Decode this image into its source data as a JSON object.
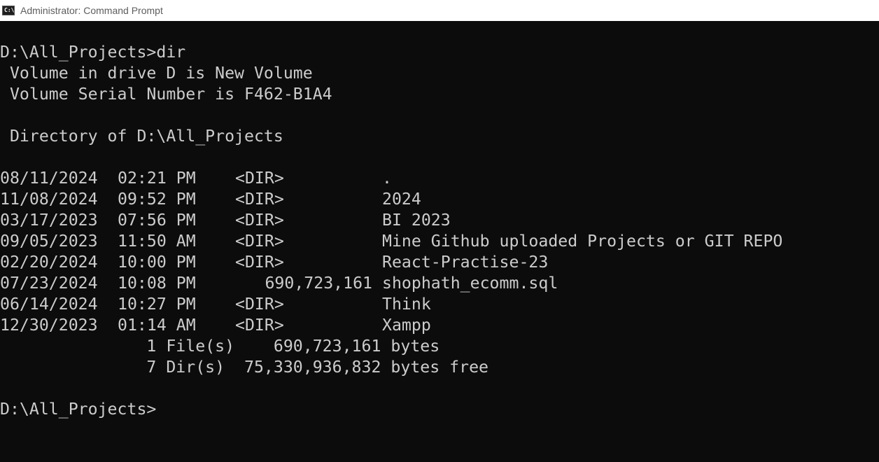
{
  "window": {
    "title": "Administrator: Command Prompt",
    "icon_label": "C:\\."
  },
  "console": {
    "prompt_command": "D:\\All_Projects>dir",
    "volume_label_line": " Volume in drive D is New Volume",
    "serial_line": " Volume Serial Number is F462-B1A4",
    "directory_line": " Directory of D:\\All_Projects",
    "entries": [
      {
        "date": "08/11/2024",
        "time": "02:21 PM",
        "type": "<DIR>",
        "size": "",
        "name": "."
      },
      {
        "date": "11/08/2024",
        "time": "09:52 PM",
        "type": "<DIR>",
        "size": "",
        "name": "2024"
      },
      {
        "date": "03/17/2023",
        "time": "07:56 PM",
        "type": "<DIR>",
        "size": "",
        "name": "BI 2023"
      },
      {
        "date": "09/05/2023",
        "time": "11:50 AM",
        "type": "<DIR>",
        "size": "",
        "name": "Mine Github uploaded Projects or GIT REPO"
      },
      {
        "date": "02/20/2024",
        "time": "10:00 PM",
        "type": "<DIR>",
        "size": "",
        "name": "React-Practise-23"
      },
      {
        "date": "07/23/2024",
        "time": "10:08 PM",
        "type": "",
        "size": "690,723,161",
        "name": "shophath_ecomm.sql"
      },
      {
        "date": "06/14/2024",
        "time": "10:27 PM",
        "type": "<DIR>",
        "size": "",
        "name": "Think"
      },
      {
        "date": "12/30/2023",
        "time": "01:14 AM",
        "type": "<DIR>",
        "size": "",
        "name": "Xampp"
      }
    ],
    "summary_files": "               1 File(s)    690,723,161 bytes",
    "summary_dirs": "               7 Dir(s)  75,330,936,832 bytes free",
    "prompt_final": "D:\\All_Projects>"
  },
  "colors": {
    "console_bg": "#0c0c0c",
    "console_text": "#cccccc",
    "titlebar_bg": "#ffffff",
    "title_text": "#5d5d5d"
  }
}
